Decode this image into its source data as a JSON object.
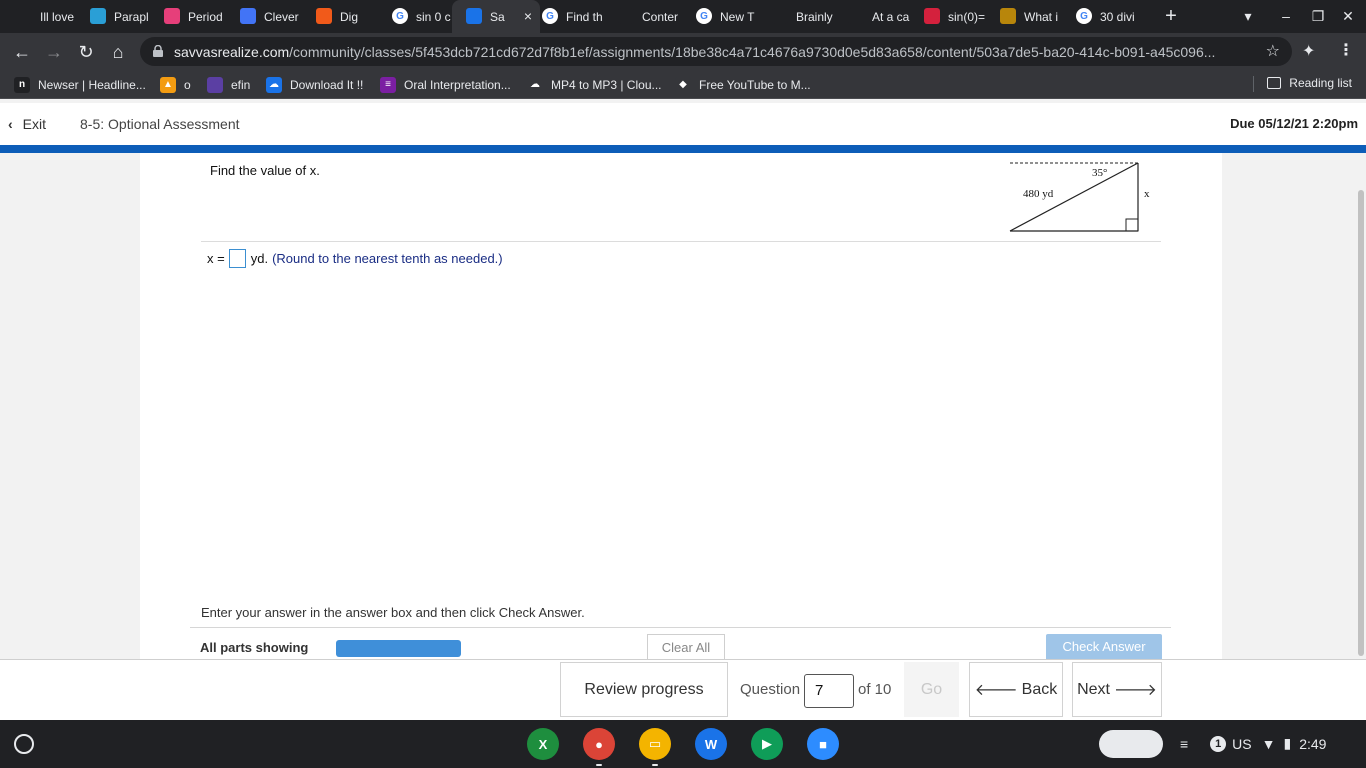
{
  "browser": {
    "tabs": [
      {
        "label": "Ill love",
        "icon": "brainly-icon",
        "color": "#202124"
      },
      {
        "label": "Parapl",
        "icon": "copy-icon",
        "color": "#2a9fd6"
      },
      {
        "label": "Period",
        "icon": "classroom-icon",
        "color": "#e63f7a"
      },
      {
        "label": "Clever",
        "icon": "clever-icon",
        "color": "#4274f6"
      },
      {
        "label": "Dig",
        "icon": "soundcloud-icon",
        "color": "#f15a1a"
      },
      {
        "label": "sin 0 c",
        "icon": "google-icon",
        "color": "#ffffff"
      },
      {
        "label": "Sa",
        "icon": "savvas-icon",
        "color": "#1a73e8"
      },
      {
        "label": "Find th",
        "icon": "google-icon",
        "color": "#ffffff"
      },
      {
        "label": "Conter",
        "icon": "content-icon",
        "color": "#202124"
      },
      {
        "label": "New T",
        "icon": "globe-icon",
        "color": "#ffffff"
      },
      {
        "label": "Brainly",
        "icon": "brainly-icon",
        "color": "#202124"
      },
      {
        "label": "At a ca",
        "icon": "brainly-icon",
        "color": "#202124"
      },
      {
        "label": "sin(0)=",
        "icon": "symbolab-icon",
        "color": "#d4213d"
      },
      {
        "label": "What i",
        "icon": "quizlet-icon",
        "color": "#b8860b"
      },
      {
        "label": "30 divi",
        "icon": "google-icon",
        "color": "#ffffff"
      }
    ],
    "active_tab_close": "×",
    "new_tab": "+",
    "url_host": "savvasrealize.com",
    "url_path": "/community/classes/5f453dcb721cd672d7f8b1ef/assignments/18be38c4a71c4676a9730d0e5d83a658/content/503a7de5-ba20-414c-b091-a45c096...",
    "bookmarks": [
      {
        "label": "Newser | Headline...",
        "icon": "newser-icon",
        "color": "#202124",
        "glyph": "n"
      },
      {
        "label": "o",
        "icon": "bookmark-icon",
        "color": "#f39c12",
        "glyph": "▲"
      },
      {
        "label": "efin",
        "icon": "bookmark-icon",
        "color": "#5b3fa3",
        "glyph": ""
      },
      {
        "label": "Download It !!",
        "icon": "cloud-icon",
        "color": "#1a73e8",
        "glyph": "☁"
      },
      {
        "label": "Oral Interpretation...",
        "icon": "list-icon",
        "color": "#7b1fa2",
        "glyph": "≡"
      },
      {
        "label": "MP4 to MP3 | Clou...",
        "icon": "cloud-icon",
        "color": "#35363a",
        "glyph": "☁"
      },
      {
        "label": "Free YouTube to M...",
        "icon": "youtube-icon",
        "color": "#35363a",
        "glyph": "◆"
      }
    ],
    "reading_list": "Reading list"
  },
  "header": {
    "exit_label": "Exit",
    "title": "8-5: Optional Assessment",
    "due": "Due 05/12/21 2:20pm"
  },
  "question": {
    "prompt": "Find the value of x.",
    "figure": {
      "angle_label": "35°",
      "hyp_label": "480 yd",
      "side_label": "x"
    },
    "answer_prefix": "x =",
    "answer_value": "",
    "answer_unit": "yd.",
    "hint": "(Round to the nearest tenth as needed.)",
    "instruction": "Enter your answer in the answer box and then click Check Answer.",
    "parts_label": "All parts showing",
    "clear_all": "Clear All",
    "check_answer": "Check Answer"
  },
  "footer": {
    "review_progress": "Review progress",
    "question_label": "Question",
    "question_number": "7",
    "of_total": "of 10",
    "go": "Go",
    "back": "Back",
    "next": "Next"
  },
  "shelf": {
    "apps": [
      {
        "name": "sheets",
        "color": "#1e8e3e",
        "glyph": "X"
      },
      {
        "name": "chrome",
        "color": "#db4437",
        "glyph": "●"
      },
      {
        "name": "slides",
        "color": "#f4b400",
        "glyph": "▭"
      },
      {
        "name": "docs",
        "color": "#1a73e8",
        "glyph": "W"
      },
      {
        "name": "play-store",
        "color": "#0f9d58",
        "glyph": "▶"
      },
      {
        "name": "zoom",
        "color": "#2d8cff",
        "glyph": "■"
      }
    ],
    "notification_count": "1",
    "locale": "US",
    "time": "2:49"
  }
}
